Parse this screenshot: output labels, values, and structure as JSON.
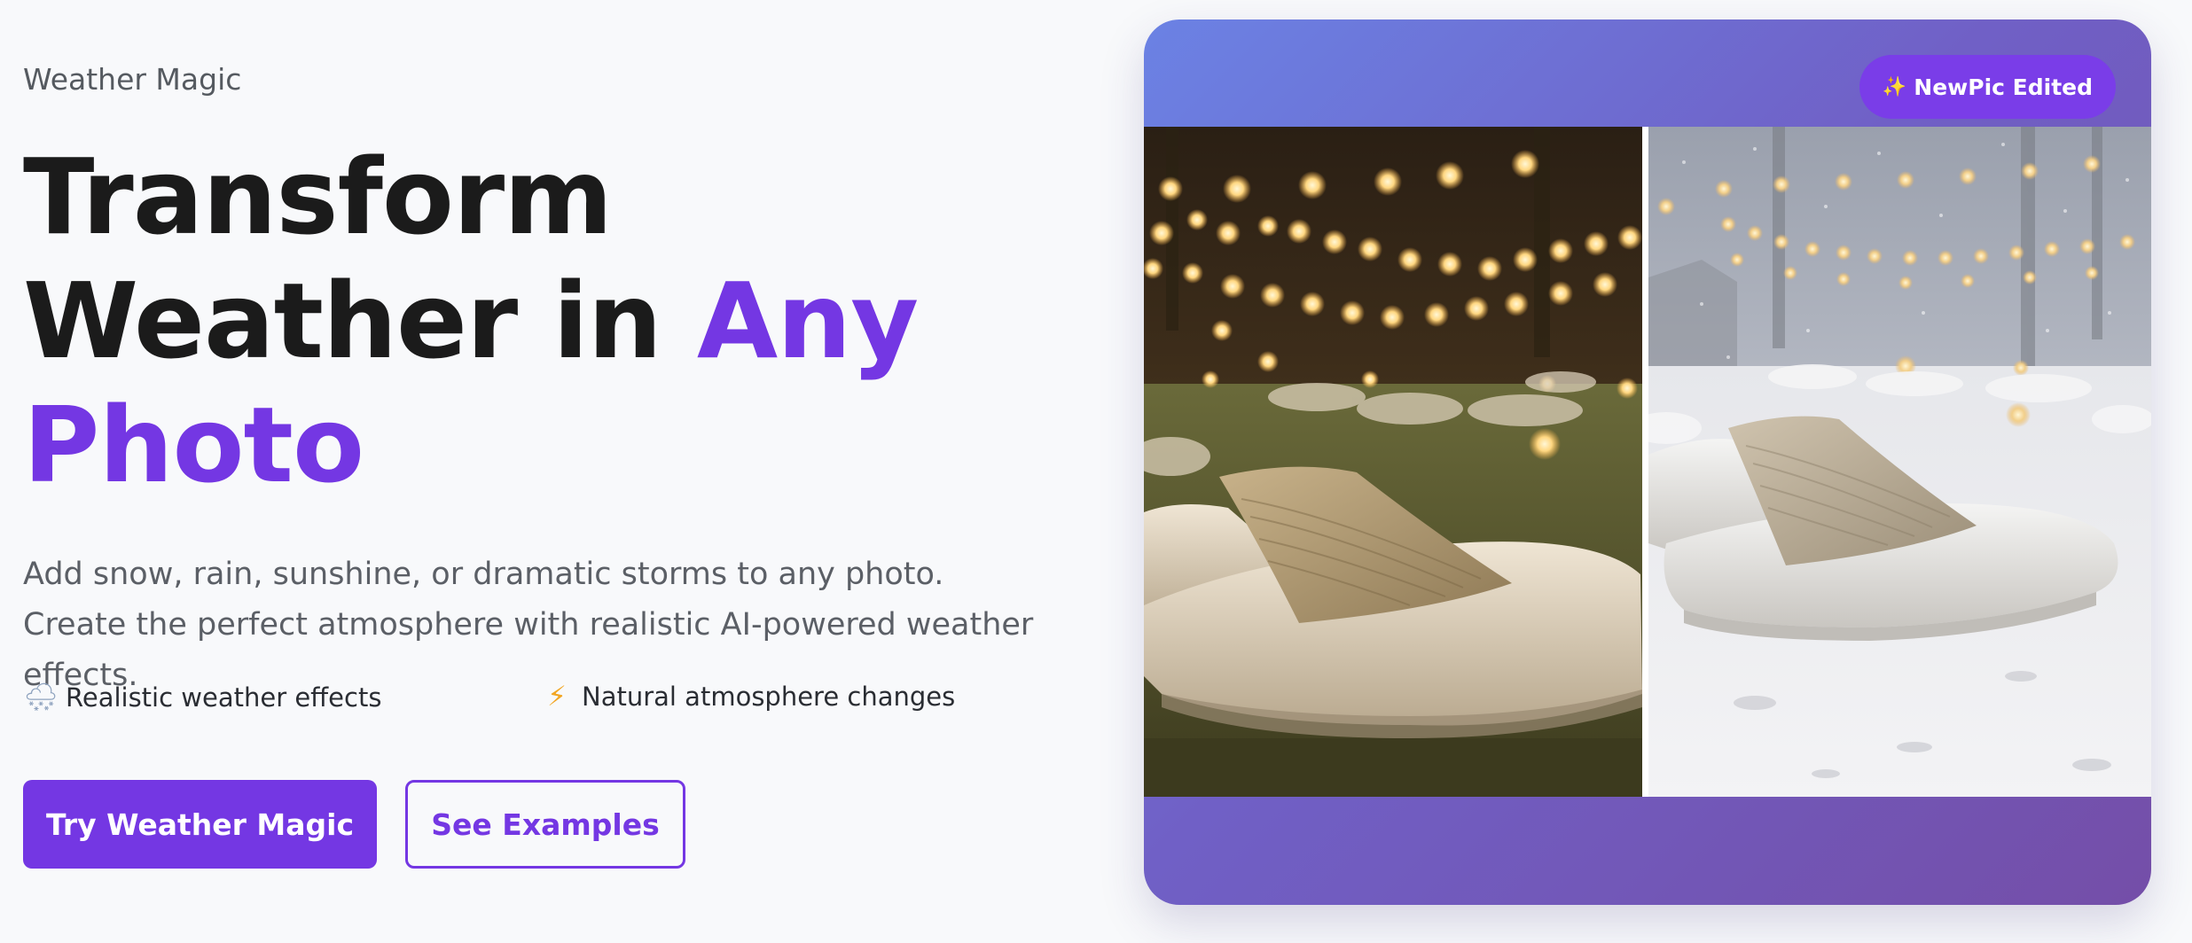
{
  "brand": "Weather Magic",
  "headline": {
    "line1": "Transform",
    "line2_prefix": "Weather in ",
    "line2_accent": "Any",
    "line3_accent": "Photo"
  },
  "subtitle": "Add snow, rain, sunshine, or dramatic storms to any photo. Create the perfect atmosphere with realistic AI-powered weather effects.",
  "features": [
    {
      "icon": "snow-cloud-icon",
      "glyph": "🌨",
      "label": "Realistic weather effects"
    },
    {
      "icon": "lightning-icon",
      "glyph": "⚡",
      "label": "Natural atmosphere changes"
    }
  ],
  "buttons": {
    "primary": "Try Weather Magic",
    "secondary": "See Examples"
  },
  "preview": {
    "badge_icon": "✨",
    "badge_text": "NewPic Edited",
    "before_image": "outdoor-garden-night-string-lights-cushions",
    "after_image": "snowy-garden-string-lights-cushions"
  },
  "colors": {
    "accent": "#7437e3",
    "text_dark": "#1b1b1b",
    "text_muted": "#5b5f66",
    "background": "#f8f9fb",
    "card_gradient_start": "#6b82e4",
    "card_gradient_end": "#744ea8"
  }
}
